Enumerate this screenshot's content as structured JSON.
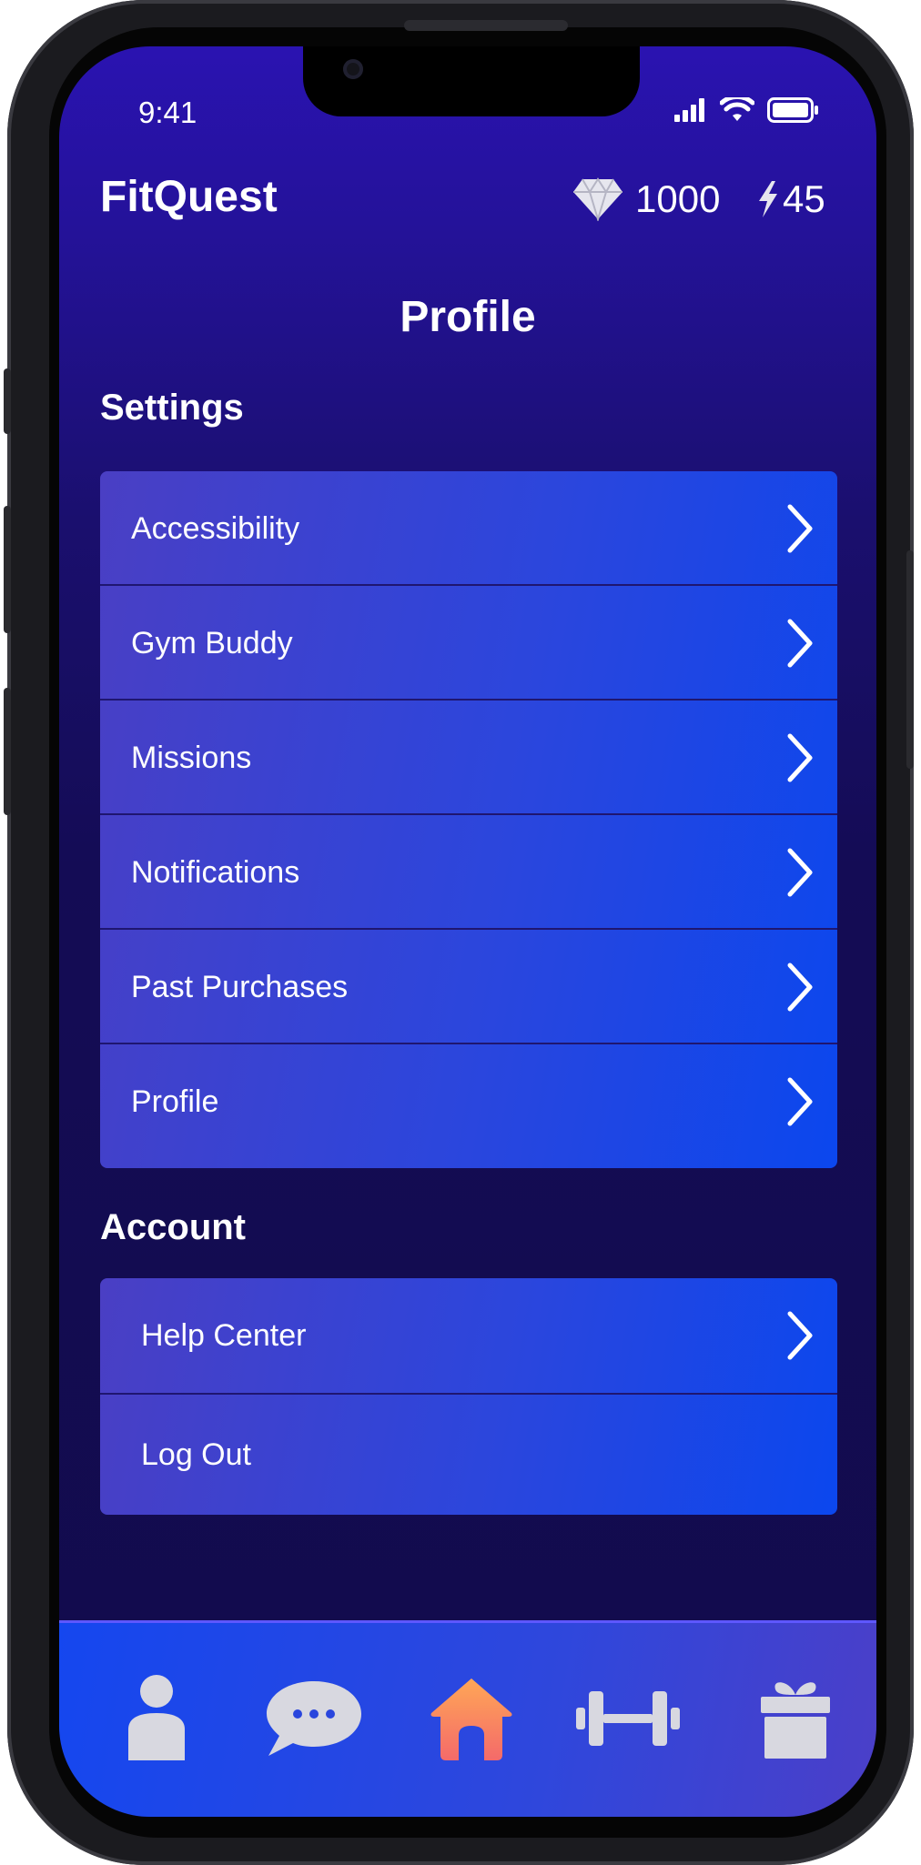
{
  "status_bar": {
    "time": "9:41"
  },
  "header": {
    "app_title": "FitQuest",
    "gems": "1000",
    "energy": "45"
  },
  "page_title": "Profile",
  "settings": {
    "title": "Settings",
    "items": [
      {
        "label": "Accessibility"
      },
      {
        "label": "Gym Buddy"
      },
      {
        "label": "Missions"
      },
      {
        "label": "Notifications"
      },
      {
        "label": "Past Purchases"
      },
      {
        "label": "Profile"
      }
    ]
  },
  "account": {
    "title": "Account",
    "items": [
      {
        "label": "Help Center"
      },
      {
        "label": "Log Out"
      }
    ]
  },
  "tab_bar": {
    "tabs": [
      {
        "icon": "person-icon"
      },
      {
        "icon": "chat-icon"
      },
      {
        "icon": "home-icon",
        "active": true
      },
      {
        "icon": "dumbbell-icon"
      },
      {
        "icon": "gift-icon"
      }
    ],
    "active_color": "#ff9a5a",
    "inactive_color": "#d8d8e0"
  }
}
